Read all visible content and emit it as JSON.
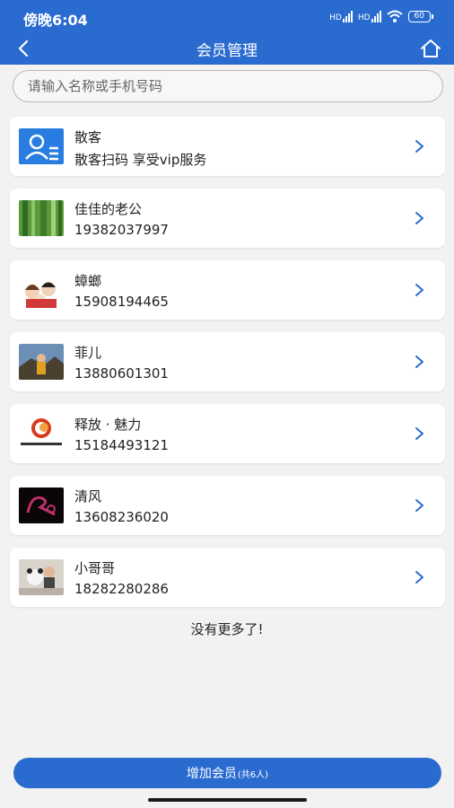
{
  "status_bar": {
    "time": "傍晚6:04",
    "battery": "60",
    "network_1": "HD",
    "network_2": "HD"
  },
  "header": {
    "title": "会员管理"
  },
  "search": {
    "placeholder": "请输入名称或手机号码"
  },
  "members": [
    {
      "name": "散客",
      "sub": "散客扫码 享受vip服务",
      "avatar": "guest-card-icon"
    },
    {
      "name": "佳佳的老公",
      "sub": "19382037997",
      "avatar": "bamboo-photo"
    },
    {
      "name": "蟑螂",
      "sub": "15908194465",
      "avatar": "cartoon-family-photo"
    },
    {
      "name": "菲儿",
      "sub": "13880601301",
      "avatar": "mountain-child-photo"
    },
    {
      "name": "释放 · 魅力",
      "sub": "15184493121",
      "avatar": "logo-photo"
    },
    {
      "name": "清风",
      "sub": "13608236020",
      "avatar": "dark-logo-photo"
    },
    {
      "name": "小哥哥",
      "sub": "18282280286",
      "avatar": "bear-photo"
    }
  ],
  "footer": {
    "no_more": "没有更多了!",
    "add_label": "增加会员",
    "add_count": "(共6人)"
  },
  "colors": {
    "primary": "#2a6bd0",
    "background": "#f2f2f2"
  }
}
